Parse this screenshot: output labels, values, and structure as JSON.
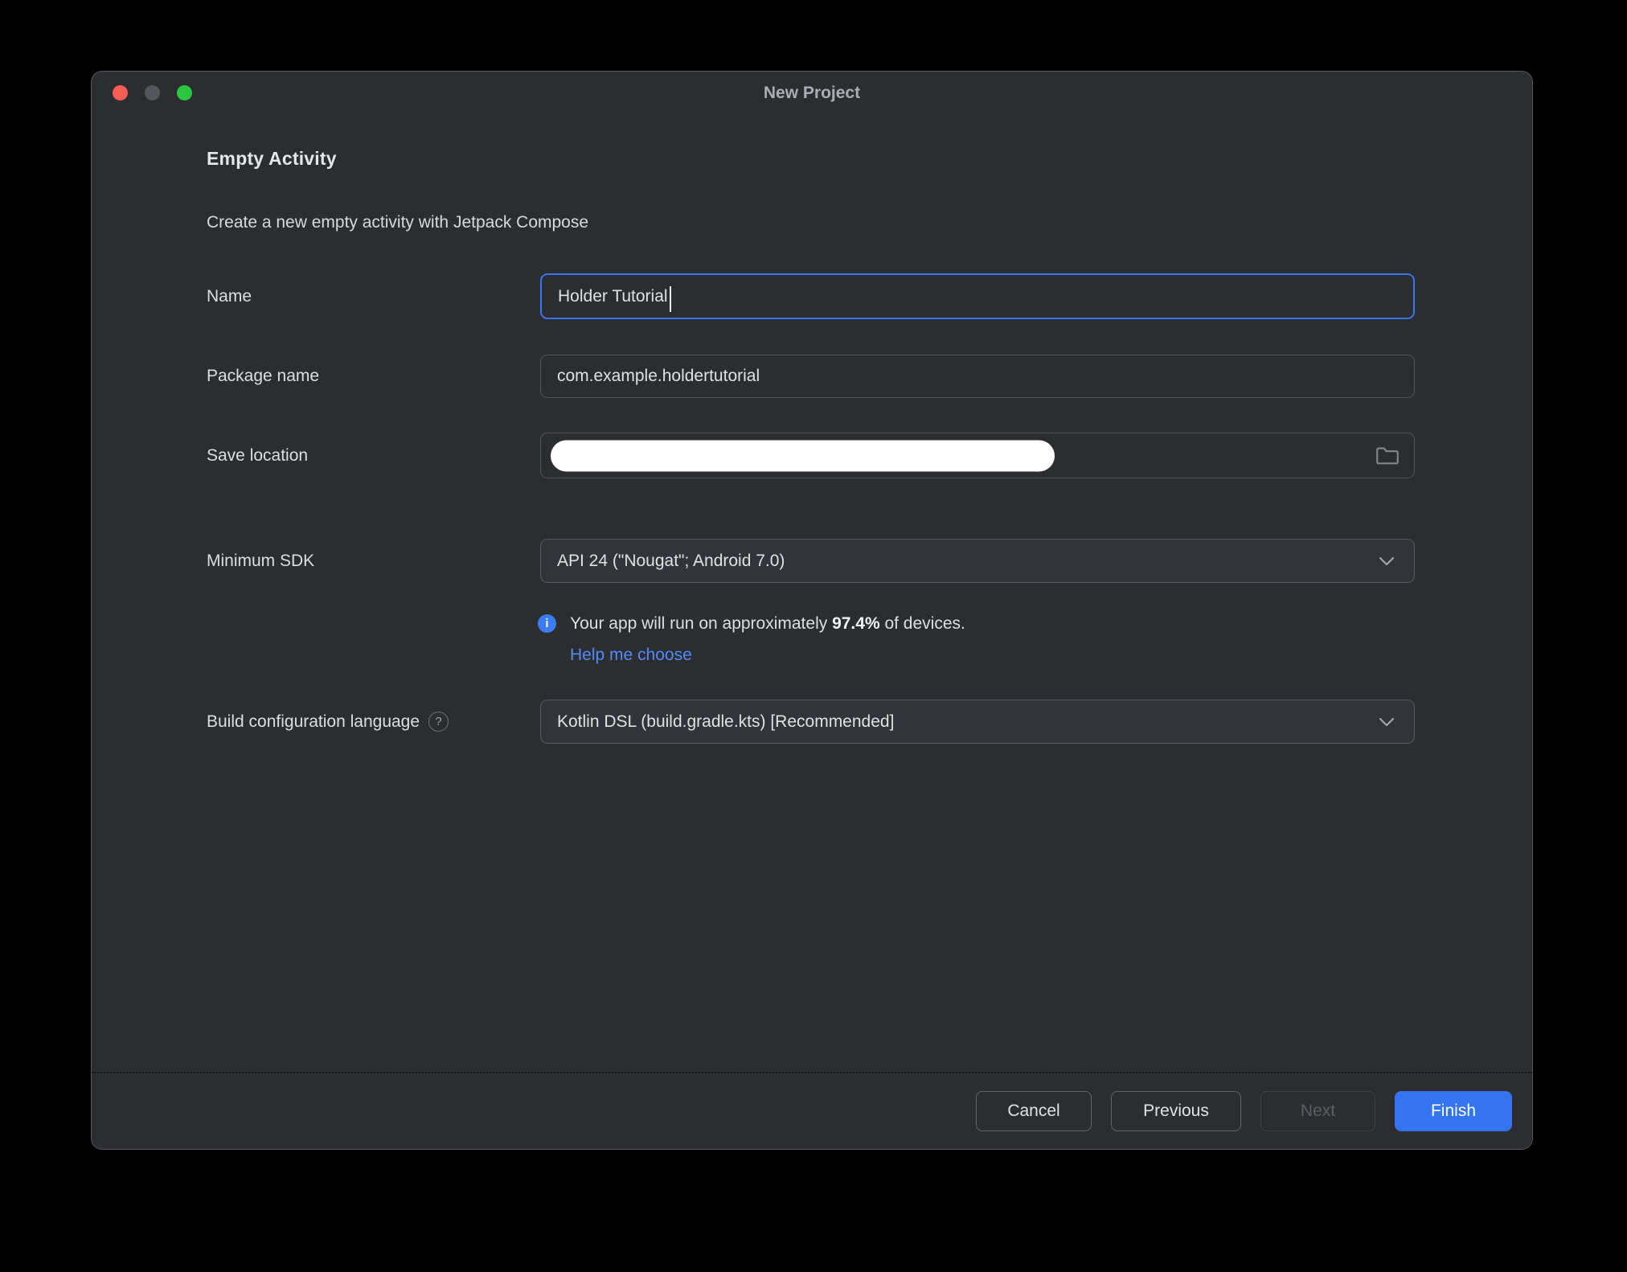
{
  "window": {
    "title": "New Project"
  },
  "header": {
    "title": "Empty Activity",
    "subtitle": "Create a new empty activity with Jetpack Compose"
  },
  "form": {
    "name": {
      "label": "Name",
      "value": "Holder Tutorial"
    },
    "package": {
      "label": "Package name",
      "value": "com.example.holdertutorial"
    },
    "save_location": {
      "label": "Save location",
      "value": ""
    },
    "min_sdk": {
      "label": "Minimum SDK",
      "value": "API 24 (\"Nougat\"; Android 7.0)"
    },
    "sdk_info": {
      "text_prefix": "Your app will run on approximately ",
      "percent": "97.4%",
      "text_suffix": " of devices.",
      "link": "Help me choose"
    },
    "build_config": {
      "label": "Build configuration language",
      "help_glyph": "?",
      "value": "Kotlin DSL (build.gradle.kts) [Recommended]"
    }
  },
  "footer": {
    "cancel": "Cancel",
    "previous": "Previous",
    "next": "Next",
    "finish": "Finish"
  },
  "info_icon_glyph": "i",
  "colors": {
    "accent_blue": "#3574F0",
    "link_blue": "#548AF7",
    "info_icon_blue": "#3B7CF2",
    "window_bg": "#2B2D30",
    "traffic_red": "#F85E55",
    "traffic_gray": "#53565A",
    "traffic_green": "#2AC73F"
  }
}
